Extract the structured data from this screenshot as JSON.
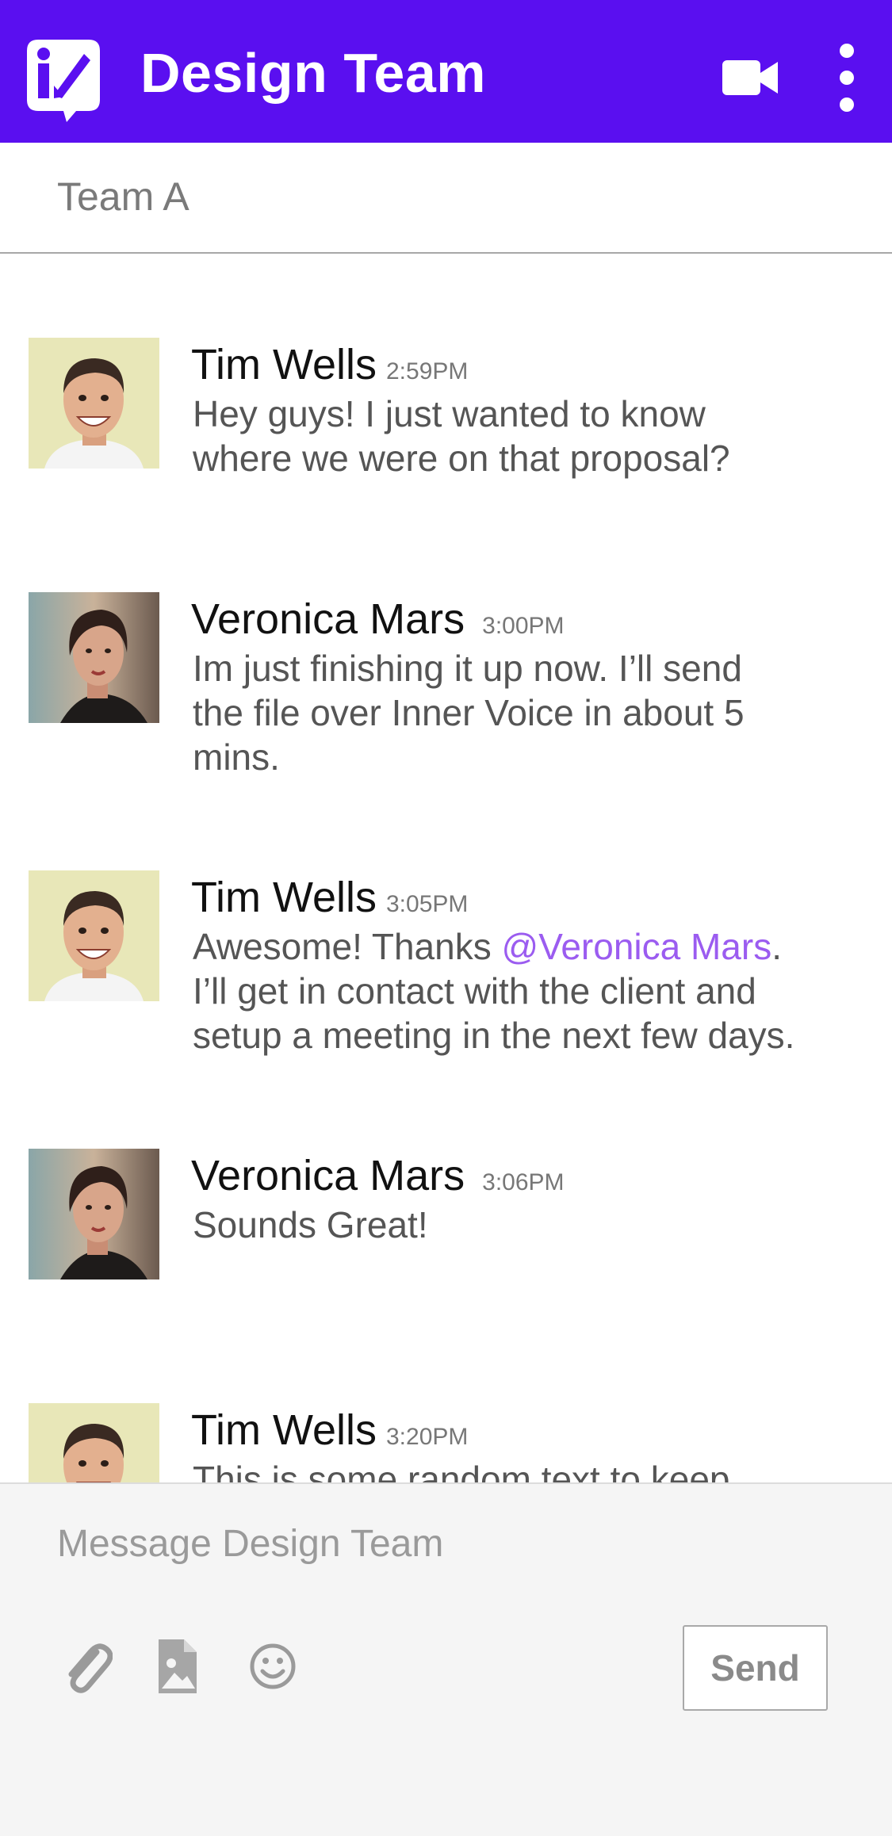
{
  "header": {
    "title": "Design Team",
    "logo_icon": "inner-voice-logo-icon",
    "video_icon": "video-camera-icon",
    "more_icon": "more-vertical-icon",
    "background": "#5a0ff0"
  },
  "channel": {
    "name": "Team A"
  },
  "messages": [
    {
      "author": "Tim Wells",
      "time": "2:59PM",
      "avatar": "tim-wells-avatar",
      "lines": [
        "Hey guys! I just wanted to know",
        "where we were on that proposal?"
      ]
    },
    {
      "author": "Veronica Mars",
      "time": "3:00PM",
      "avatar": "veronica-mars-avatar",
      "lines": [
        "Im just finishing it up now. I’ll send",
        "the file over Inner Voice in about 5",
        "mins."
      ]
    },
    {
      "author": "Tim Wells",
      "time": "3:05PM",
      "avatar": "tim-wells-avatar",
      "text_before_mention": "Awesome! Thanks ",
      "mention": "@Veronica Mars",
      "text_after_mention": ".",
      "lines": [
        "I’ll get in contact with the client and",
        "setup a meeting in the next few days."
      ]
    },
    {
      "author": "Veronica Mars",
      "time": "3:06PM",
      "avatar": "veronica-mars-avatar",
      "lines": [
        "Sounds Great!"
      ]
    },
    {
      "author": "Tim Wells",
      "time": "3:20PM",
      "avatar": "tim-wells-avatar",
      "lines": [
        "This is some random text to keep"
      ]
    }
  ],
  "composer": {
    "placeholder": "Message Design Team",
    "send_label": "Send",
    "tools": [
      "paperclip-icon",
      "image-file-icon",
      "smiley-icon"
    ]
  },
  "colors": {
    "accent": "#5a0ff0",
    "mention": "#9b5cf0",
    "composer_bg": "#f5f5f5"
  }
}
